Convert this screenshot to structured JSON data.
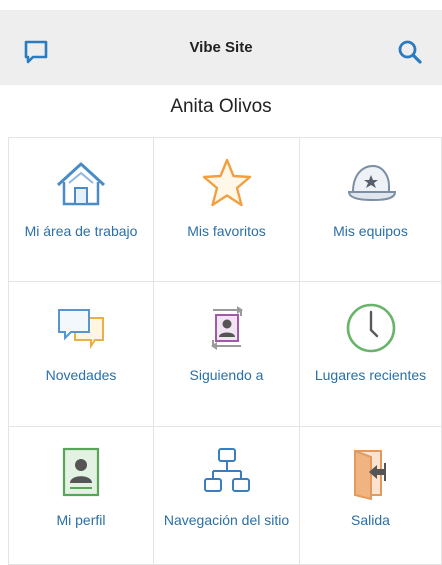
{
  "header": {
    "title": "Vibe Site"
  },
  "user": {
    "name": "Anita Olivos"
  },
  "tiles": [
    {
      "label": "Mi área de trabajo",
      "icon": "home-icon"
    },
    {
      "label": "Mis favoritos",
      "icon": "star-icon"
    },
    {
      "label": "Mis equipos",
      "icon": "team-cap-icon"
    },
    {
      "label": "Novedades",
      "icon": "speech-bubbles-icon"
    },
    {
      "label": "Siguiendo a",
      "icon": "following-icon"
    },
    {
      "label": "Lugares recientes",
      "icon": "clock-icon"
    },
    {
      "label": "Mi perfil",
      "icon": "profile-icon"
    },
    {
      "label": "Navegación del sitio",
      "icon": "sitemap-icon"
    },
    {
      "label": "Salida",
      "icon": "logout-door-icon"
    }
  ],
  "colors": {
    "link": "#2a6fa8",
    "header_bg": "#eeeeee",
    "icon_blue": "#3a7ec0",
    "star_orange": "#f0a040"
  }
}
